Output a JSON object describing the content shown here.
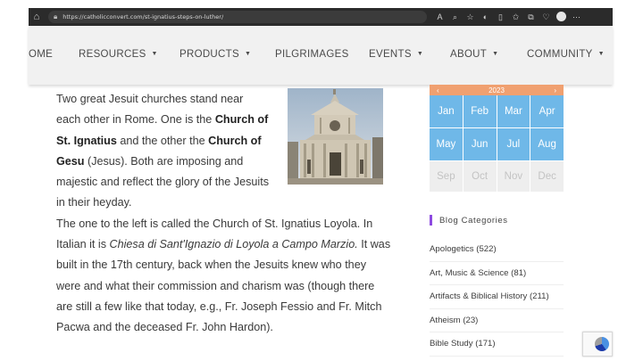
{
  "browser": {
    "url": "https://catholicconvert.com/st-ignatius-steps-on-luther/",
    "icons": [
      "home-icon",
      "lock-icon",
      "read-aloud-icon",
      "zoom-icon",
      "favorite-icon",
      "extension-icon",
      "split-screen-icon",
      "favorites-icon",
      "collections-icon",
      "browser-essentials-icon",
      "profile-icon",
      "more-icon"
    ]
  },
  "nav": {
    "items": [
      {
        "label": "OME",
        "caret": false
      },
      {
        "label": "RESOURCES",
        "caret": true
      },
      {
        "label": "PRODUCTS",
        "caret": true
      },
      {
        "label": "PILGRIMAGES",
        "caret": false
      },
      {
        "label": "EVENTS",
        "caret": true
      },
      {
        "label": "ABOUT",
        "caret": true
      },
      {
        "label": "COMMUNITY",
        "caret": true
      }
    ]
  },
  "article": {
    "p1_a": "Two great Jesuit churches stand near each other in Rome. One is the ",
    "p1_b": "Church of St. Ignatius",
    "p1_c": " and the other the ",
    "p1_d": "Church of Gesu",
    "p1_e": " (Jesus). Both are imposing and majestic and reflect the glory of the Jesuits in their heyday.",
    "p2_a": "The one to the left is called the Church of St. Ignatius Loyola. In Italian it is ",
    "p2_b": "Chiesa di Sant'Ignazio di Loyola a Campo Marzio.",
    "p2_c": " It was built in the 17th century, back when the Jesuits knew who they were and what their commission and charism was (though there are still a few like that today, e.g., Fr. Joseph Fessio and Fr. Mitch Pacwa and the deceased Fr. John Hardon)."
  },
  "calendar": {
    "prev": "‹",
    "year": "2023",
    "next": "›",
    "months": [
      {
        "label": "Jan",
        "active": true
      },
      {
        "label": "Feb",
        "active": true
      },
      {
        "label": "Mar",
        "active": true
      },
      {
        "label": "Apr",
        "active": true
      },
      {
        "label": "May",
        "active": true
      },
      {
        "label": "Jun",
        "active": true
      },
      {
        "label": "Jul",
        "active": true
      },
      {
        "label": "Aug",
        "active": true
      },
      {
        "label": "Sep",
        "active": false
      },
      {
        "label": "Oct",
        "active": false
      },
      {
        "label": "Nov",
        "active": false
      },
      {
        "label": "Dec",
        "active": false
      }
    ]
  },
  "blog_categories": {
    "title": "Blog Categories",
    "items": [
      "Apologetics (522)",
      "Art, Music & Science (81)",
      "Artifacts & Biblical History (211)",
      "Atheism (23)",
      "Bible Study (171)"
    ]
  },
  "colors": {
    "calendar_active": "#6fb8e8",
    "calendar_header": "#f0a070",
    "category_accent": "#8d4ae0"
  }
}
